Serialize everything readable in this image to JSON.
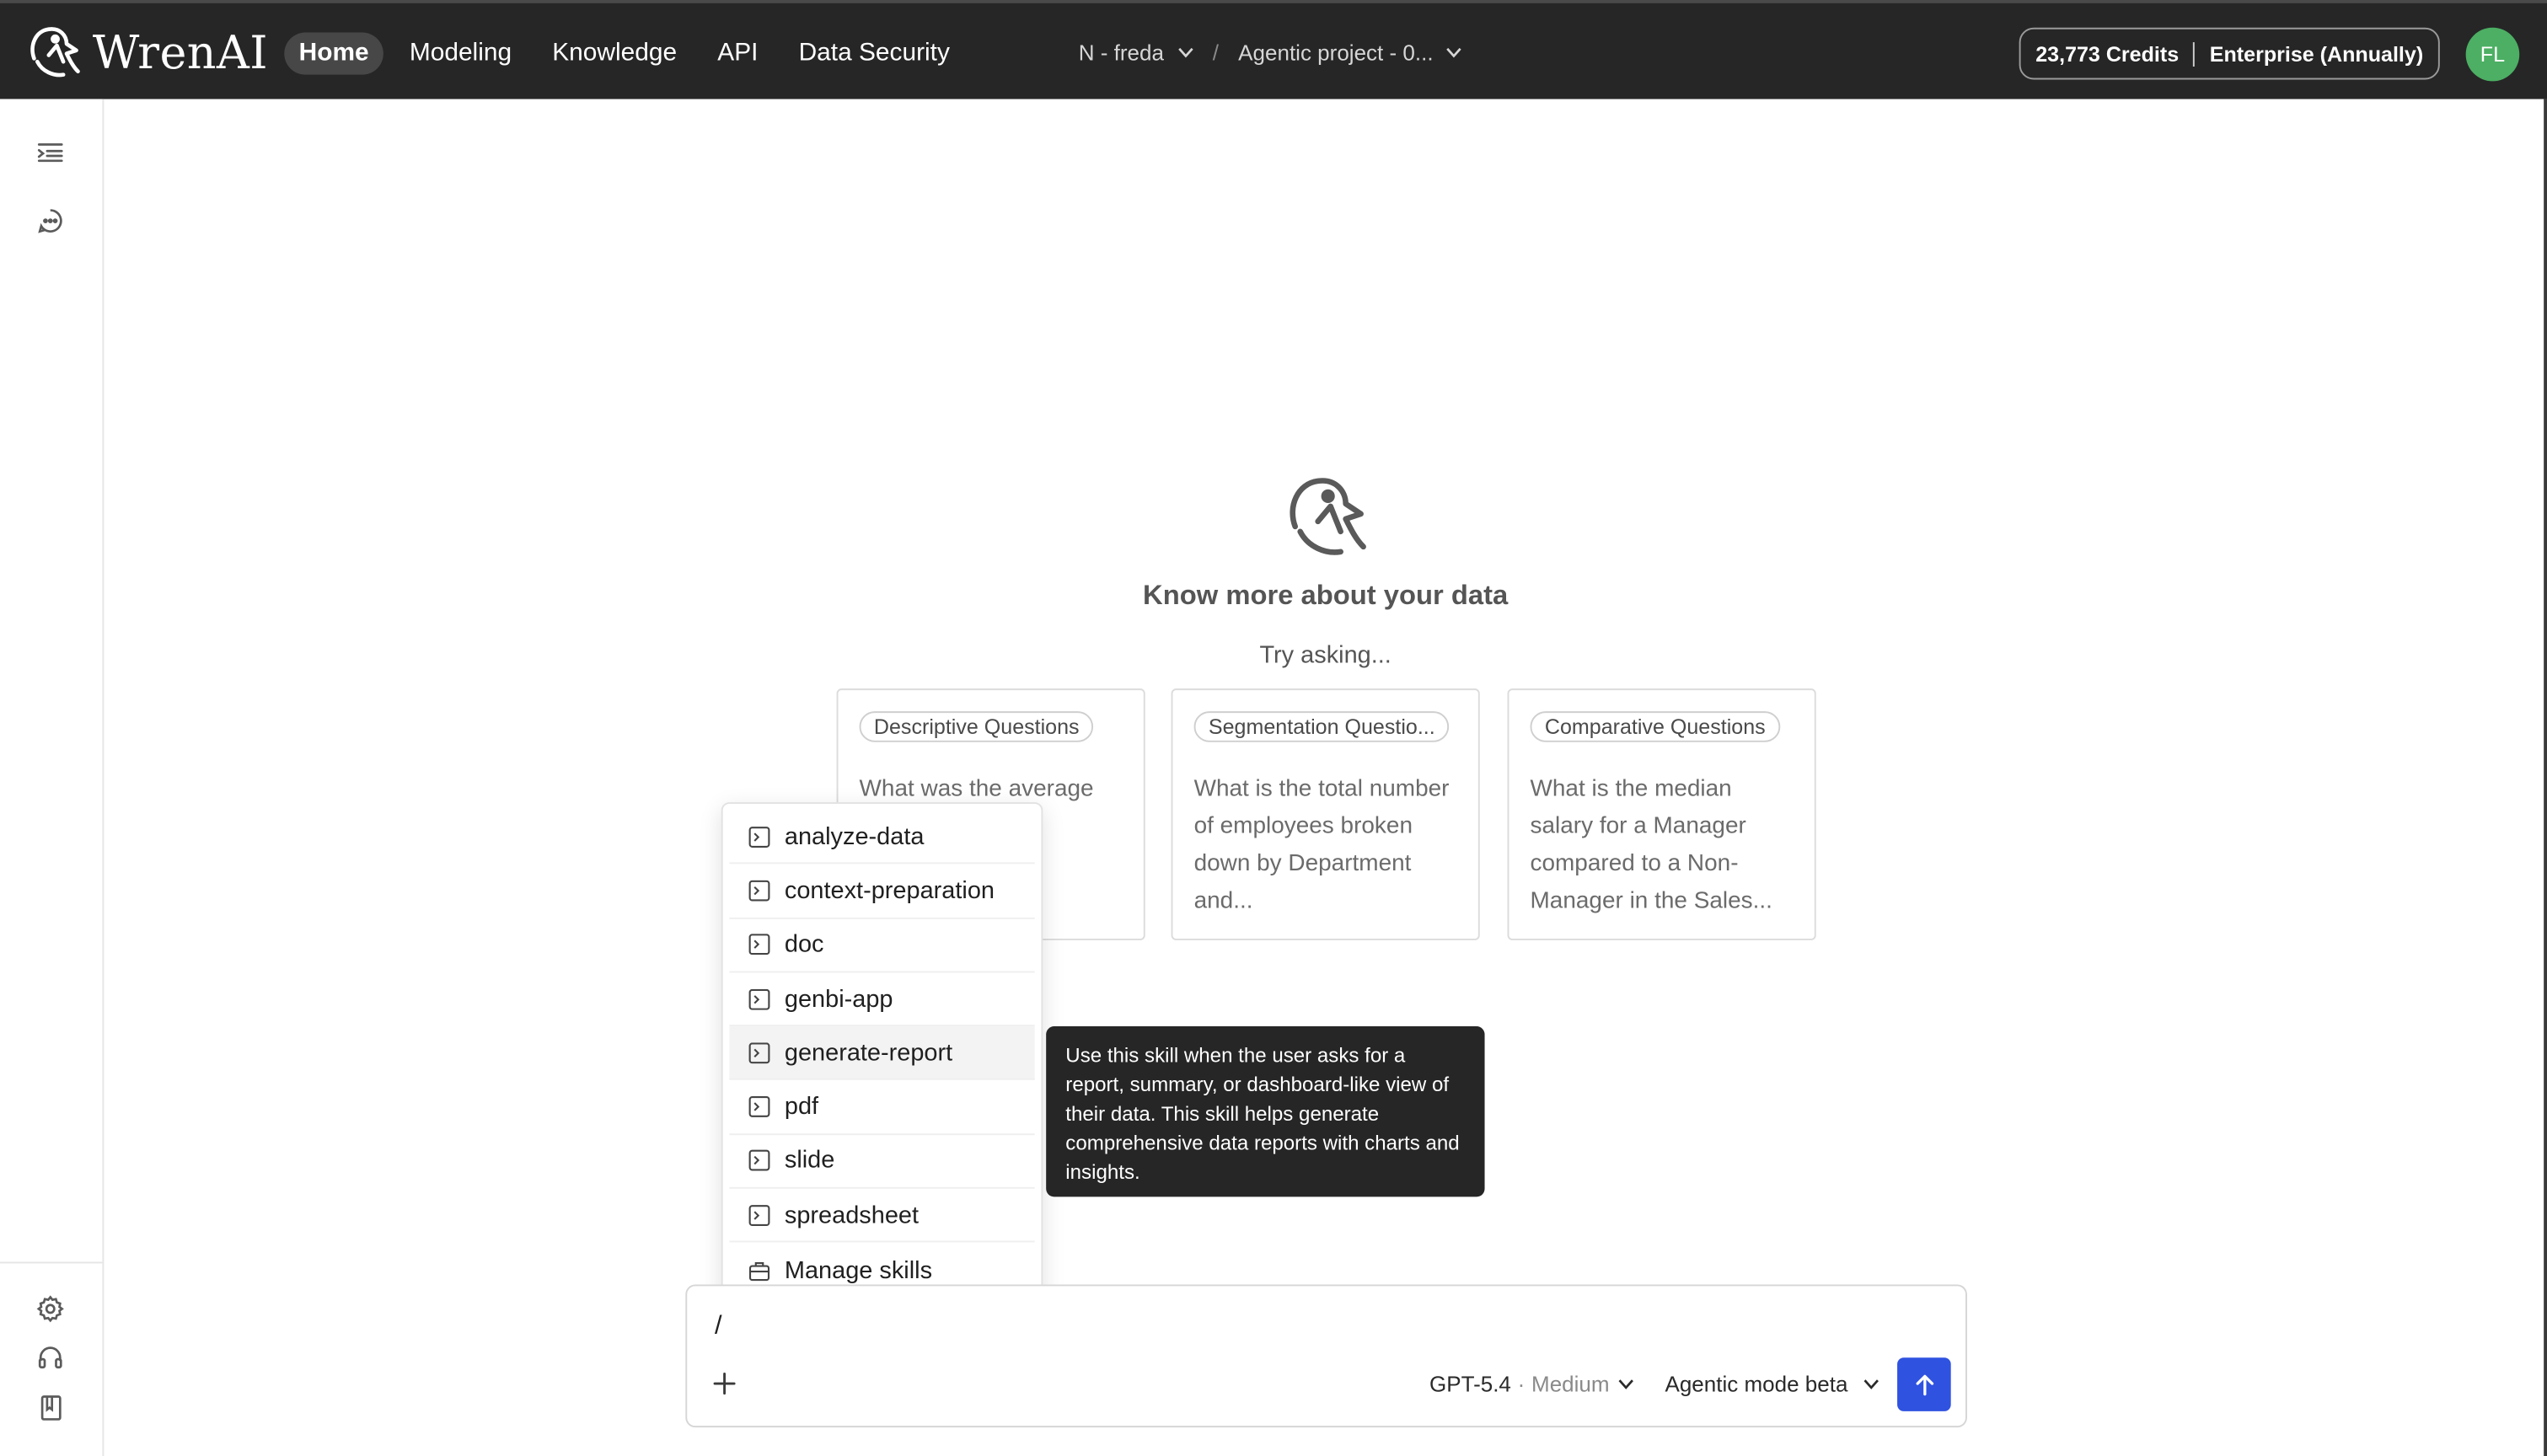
{
  "app": {
    "logo_text": "WrenAI"
  },
  "nav": {
    "items": [
      "Home",
      "Modeling",
      "Knowledge",
      "API",
      "Data Security"
    ],
    "active": "Home"
  },
  "project": {
    "workspace": "N - freda",
    "separator": "/",
    "name": "Agentic project - 0..."
  },
  "account": {
    "credits": "23,773 Credits",
    "plan": "Enterprise (Annually)",
    "avatar_initials": "FL",
    "avatar_color": "#4caf63"
  },
  "sidebar": {
    "top_icons": [
      "list-indent-icon",
      "chat-bubble-icon"
    ],
    "bottom_icons": [
      "gear-icon",
      "headset-icon",
      "book-icon"
    ]
  },
  "hero": {
    "title": "Know more about your data",
    "subtitle": "Try asking..."
  },
  "cards": [
    {
      "tag": "Descriptive Questions",
      "question": "What was the average attrition rate by department?"
    },
    {
      "tag": "Segmentation Questio...",
      "question": "What is the total number of employees broken down by Department and..."
    },
    {
      "tag": "Comparative Questions",
      "question": "What is the median salary for a Manager compared to a Non-Manager in the Sales..."
    }
  ],
  "skills_menu": {
    "items": [
      "analyze-data",
      "context-preparation",
      "doc",
      "genbi-app",
      "generate-report",
      "pdf",
      "slide",
      "spreadsheet"
    ],
    "highlighted": "generate-report",
    "manage_label": "Manage skills"
  },
  "tooltip": {
    "text": "Use this skill when the user asks for a report, summary, or dashboard-like view of their data. This skill helps generate comprehensive data reports with charts and insights."
  },
  "composer": {
    "input_value": "/",
    "model": "GPT-5.4",
    "model_dot": "·",
    "effort": "Medium",
    "mode": "Agentic mode beta",
    "send_color": "#2f52e0"
  }
}
